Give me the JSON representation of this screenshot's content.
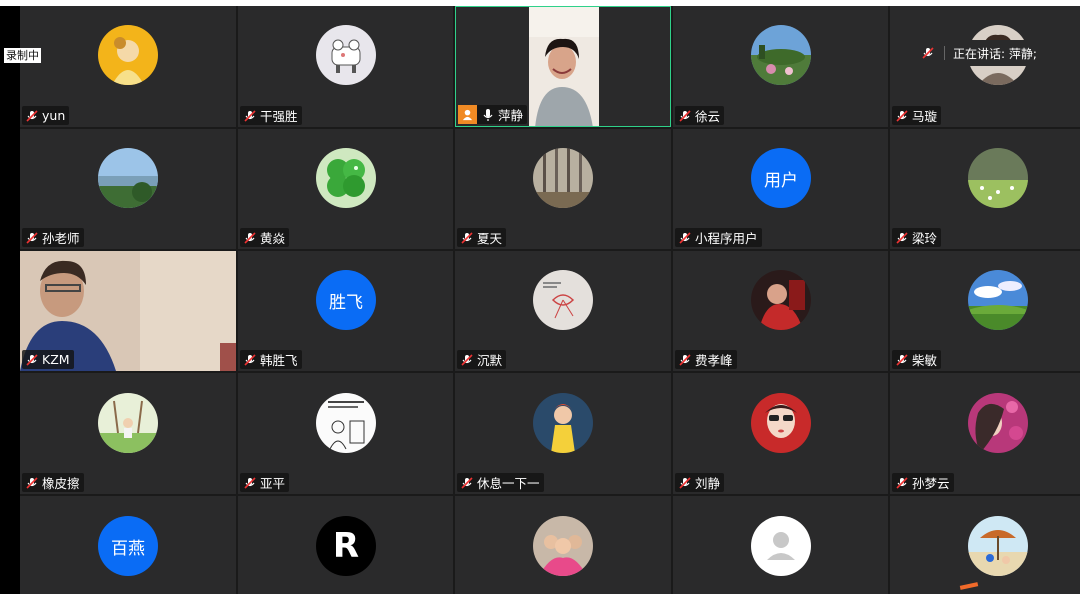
{
  "recording": {
    "label": "录制中"
  },
  "speaking": {
    "label": "正在讲话: 萍静;"
  },
  "colors": {
    "accent_blue": "#0a6cf5",
    "active_border": "#2fd18a",
    "host_orange": "#f08a24",
    "tile_bg": "#2a2a2b"
  },
  "participants": [
    {
      "name": "yun",
      "avatar": "photo-yellow-portrait",
      "mic": "muted"
    },
    {
      "name": "干强胜",
      "avatar": "cartoon-cow",
      "mic": "muted"
    },
    {
      "name": "萍静",
      "avatar": "video-feed",
      "mic": "on",
      "host": true
    },
    {
      "name": "徐云",
      "avatar": "photo-garden",
      "mic": "muted"
    },
    {
      "name": "马璇",
      "avatar": "photo-portrait",
      "mic": "muted"
    },
    {
      "name": "孙老师",
      "avatar": "photo-lake",
      "mic": "muted"
    },
    {
      "name": "黄焱",
      "avatar": "photo-clover",
      "mic": "muted"
    },
    {
      "name": "夏天",
      "avatar": "photo-forest",
      "mic": "muted"
    },
    {
      "name": "小程序用户",
      "avatar_text": "用户",
      "mic": "muted"
    },
    {
      "name": "梁玲",
      "avatar": "photo-meadow",
      "mic": "muted"
    },
    {
      "name": "KZM",
      "avatar": "video-feed",
      "mic": "muted"
    },
    {
      "name": "韩胜飞",
      "avatar_text": "胜飞",
      "mic": "muted"
    },
    {
      "name": "沉默",
      "avatar": "drawing-ribbon",
      "mic": "muted"
    },
    {
      "name": "费孝峰",
      "avatar": "photo-red-portrait",
      "mic": "muted"
    },
    {
      "name": "柴敏",
      "avatar": "photo-sky-field",
      "mic": "muted"
    },
    {
      "name": "橡皮擦",
      "avatar": "photo-swing",
      "mic": "muted"
    },
    {
      "name": "亚平",
      "avatar": "drawing-sketch",
      "mic": "muted"
    },
    {
      "name": "休息一下一",
      "avatar": "photo-doll",
      "mic": "muted"
    },
    {
      "name": "刘静",
      "avatar": "drawing-girl",
      "mic": "muted"
    },
    {
      "name": "孙梦云",
      "avatar": "drawing-woman-flowers",
      "mic": "muted"
    },
    {
      "name": "",
      "avatar_text": "百燕"
    },
    {
      "name": "",
      "avatar": "logo-r",
      "avatar_text": "R"
    },
    {
      "name": "",
      "avatar": "photo-group"
    },
    {
      "name": "",
      "avatar": "default-user"
    },
    {
      "name": "",
      "avatar": "photo-beach-umbrella"
    }
  ]
}
